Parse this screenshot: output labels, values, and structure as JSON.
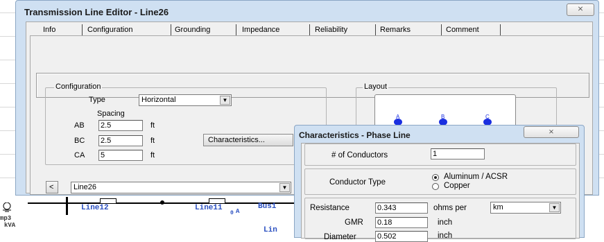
{
  "main_window": {
    "title": "Transmission Line Editor - Line26",
    "close_glyph": "⨯",
    "tabs": [
      "Info",
      "Configuration",
      "Grounding",
      "Impedance",
      "Reliability",
      "Remarks",
      "Comment"
    ],
    "active_tab": "Configuration",
    "configuration": {
      "group_label": "Configuration",
      "type_label": "Type",
      "type_value": "Horizontal",
      "spacing_label": "Spacing",
      "ab_label": "AB",
      "ab_value": "2.5",
      "bc_label": "BC",
      "bc_value": "2.5",
      "ca_label": "CA",
      "ca_value": "5",
      "unit": "ft",
      "characteristics_button": "Characteristics..."
    },
    "layout": {
      "group_label": "Layout",
      "phases": [
        "A",
        "B",
        "C"
      ],
      "phase_color": "#1a2fe0"
    },
    "nav": {
      "prev_button": "<",
      "line_select": "Line26"
    }
  },
  "characteristics_dialog": {
    "title": "Characteristics - Phase Line",
    "close_glyph": "⨯",
    "conductors_label": "# of Conductors",
    "conductors_value": "1",
    "conductor_type_label": "Conductor Type",
    "conductor_type_options": [
      "Aluminum / ACSR",
      "Copper"
    ],
    "conductor_type_selected": "Aluminum / ACSR",
    "resistance_label": "Resistance",
    "resistance_value": "0.343",
    "resistance_unit": "ohms per",
    "resistance_per": "km",
    "gmr_label": "GMR",
    "gmr_value": "0.18",
    "gmr_unit": "inch",
    "diameter_label": "Diameter",
    "diameter_value": "0.502",
    "diameter_unit": "inch"
  },
  "background_canvas": {
    "labels": [
      "Line12",
      "Line11",
      "Bus1",
      "Lin",
      "A",
      "0",
      "mp3",
      "kVA"
    ],
    "line_color": "#2a4fc0"
  }
}
